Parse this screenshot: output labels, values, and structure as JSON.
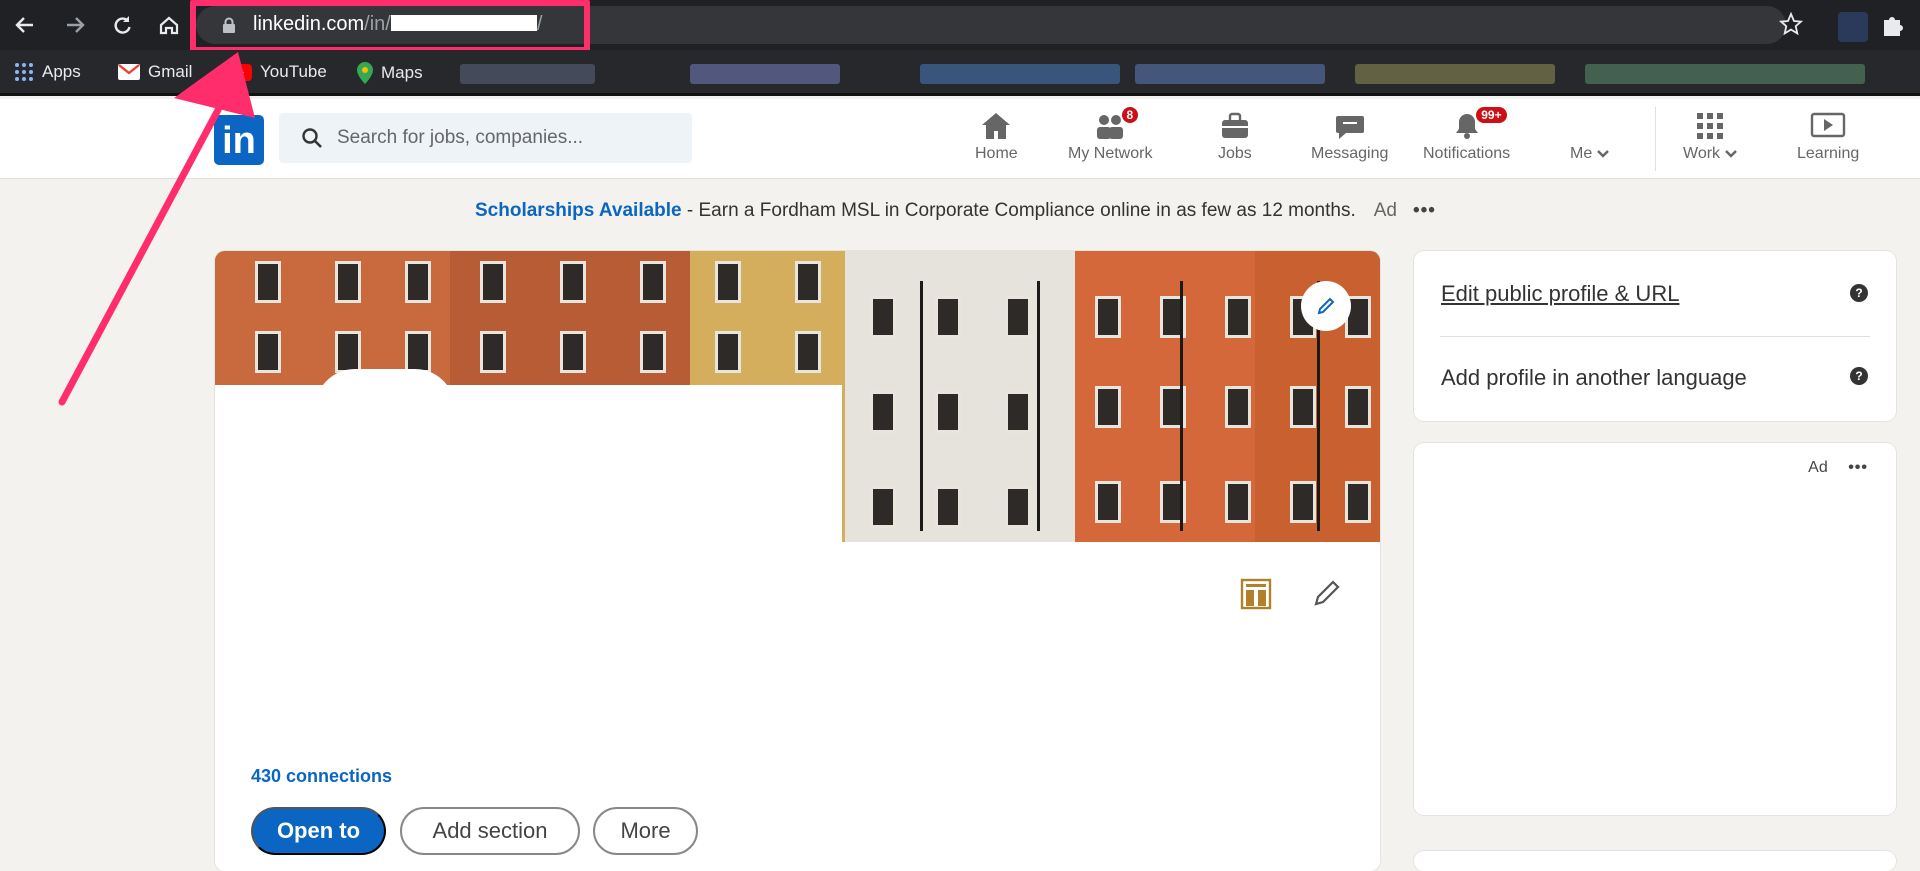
{
  "browser": {
    "url_host": "linkedin.com",
    "url_path": "/in/",
    "url_suffix": "/",
    "bookmarks": [
      {
        "label": "Apps",
        "icon": "apps-grid-icon"
      },
      {
        "label": "Gmail",
        "icon": "gmail-icon"
      },
      {
        "label": "YouTube",
        "icon": "youtube-icon"
      },
      {
        "label": "Maps",
        "icon": "maps-pin-icon"
      }
    ],
    "highlight_color": "#ff2d6b"
  },
  "linkedin_nav": {
    "logo": "in",
    "search_placeholder": "Search for jobs, companies...",
    "items": [
      {
        "label": "Home",
        "icon": "home-icon"
      },
      {
        "label": "My Network",
        "icon": "network-icon",
        "badge": "8"
      },
      {
        "label": "Jobs",
        "icon": "jobs-briefcase-icon"
      },
      {
        "label": "Messaging",
        "icon": "messaging-icon"
      },
      {
        "label": "Notifications",
        "icon": "bell-icon",
        "badge": "99+"
      },
      {
        "label": "Me",
        "icon": "chevron-down-icon"
      },
      {
        "label": "Work",
        "icon": "grid-icon"
      },
      {
        "label": "Learning",
        "icon": "learning-play-icon"
      }
    ]
  },
  "ad_banner": {
    "link": "Scholarships Available",
    "text": " - Earn a Fordham MSL in Corporate Compliance online in as few as 12 months.",
    "ad": "Ad",
    "more": "•••"
  },
  "profile": {
    "connections": "430 connections",
    "buttons": {
      "open_to": "Open to",
      "add_section": "Add section",
      "more": "More"
    }
  },
  "right_rail": {
    "edit_public_profile": "Edit public profile & URL",
    "add_language": "Add profile in another language",
    "help": "?",
    "ad": "Ad",
    "more": "•••"
  },
  "colors": {
    "linkedin_blue": "#0a66c2",
    "page_bg": "#f3f2ef",
    "badge_red": "#cc1016"
  }
}
